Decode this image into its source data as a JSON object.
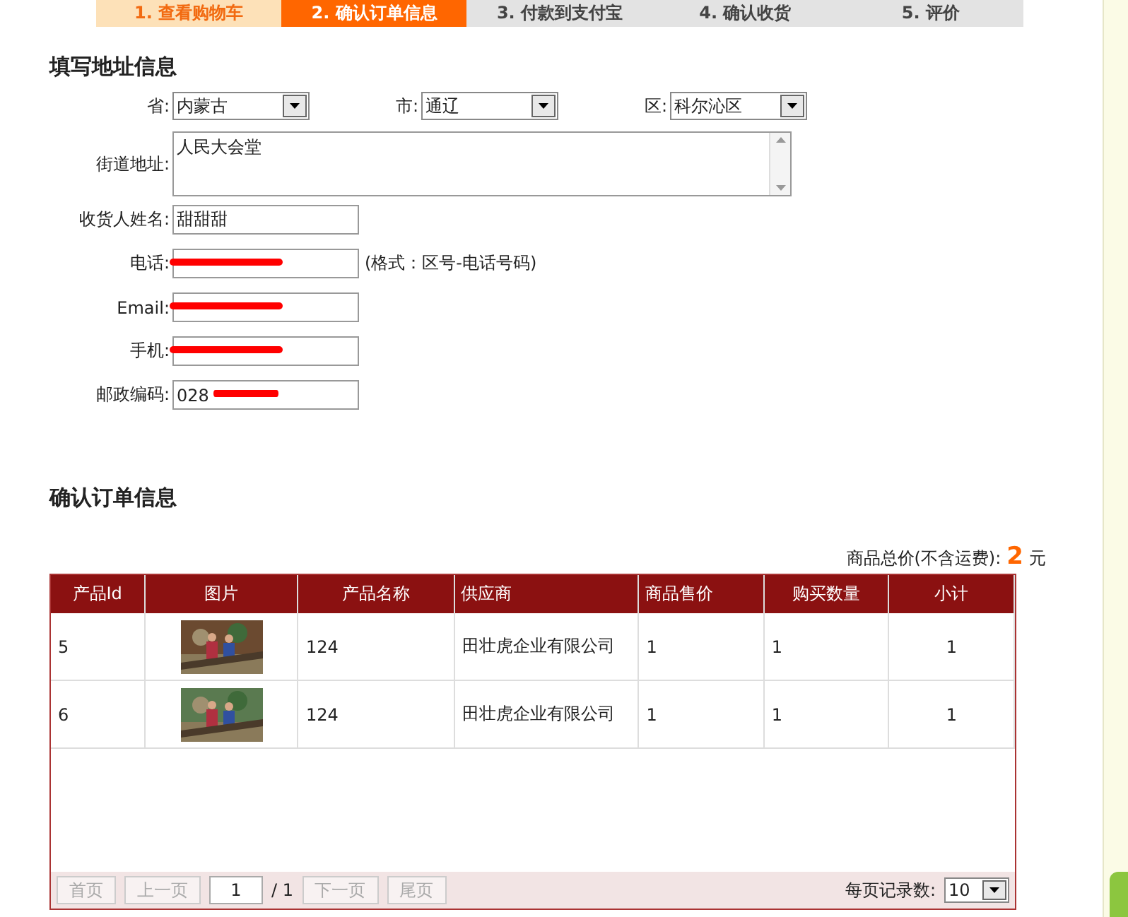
{
  "steps": [
    {
      "label": "1. 查看购物车",
      "completed": true,
      "selected": false
    },
    {
      "label": "2. 确认订单信息",
      "completed": false,
      "selected": true
    },
    {
      "label": "3. 付款到支付宝",
      "completed": false,
      "selected": false
    },
    {
      "label": "4. 确认收货",
      "completed": false,
      "selected": false
    },
    {
      "label": "5. 评价",
      "completed": false,
      "selected": false
    }
  ],
  "address_section": {
    "title": "填写地址信息",
    "region": [
      {
        "label": "省:",
        "value": "内蒙古"
      },
      {
        "label": "市:",
        "value": "通辽"
      },
      {
        "label": "区:",
        "value": "科尔沁区"
      }
    ],
    "street": {
      "label": "街道地址:",
      "value": "人民大会堂"
    },
    "fields": [
      {
        "label": "收货人姓名:",
        "value": "甜甜甜"
      },
      {
        "label": "电话:",
        "redacted": true,
        "hint": "(格式：区号-电话号码)"
      },
      {
        "label": "Email:",
        "redacted": true
      },
      {
        "label": "手机:",
        "redacted": true
      },
      {
        "label": "邮政编码:",
        "value": "028",
        "redacted": true
      }
    ]
  },
  "order_section": {
    "title": "确认订单信息",
    "total": {
      "label": "商品总价(不含运费):",
      "value": "2",
      "unit": "元"
    },
    "table": {
      "columns": [
        "产品Id",
        "图片",
        "产品名称",
        "供应商",
        "商品售价",
        "购买数量",
        "小计"
      ],
      "rows": [
        {
          "id": "5",
          "name": "124",
          "supplier": "田壮虎企业有限公司",
          "price": "1",
          "quantity": "1",
          "subtotal": "1"
        },
        {
          "id": "6",
          "name": "124",
          "supplier": "田壮虎企业有限公司",
          "price": "1",
          "quantity": "1",
          "subtotal": "1"
        }
      ]
    },
    "pager": {
      "first": "首页",
      "prev": "上一页",
      "page": "1",
      "of": "/ 1",
      "next": "下一页",
      "last": "尾页",
      "per_page_label": "每页记录数:",
      "per_page": "10"
    }
  }
}
